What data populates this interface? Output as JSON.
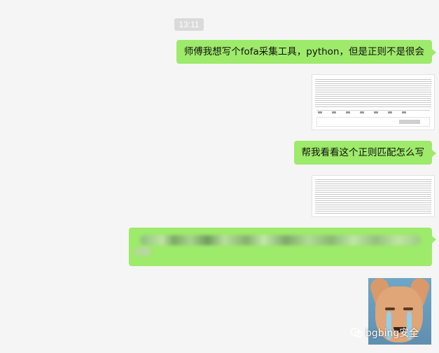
{
  "chat": {
    "timestamp": "13:11",
    "messages": [
      {
        "type": "text",
        "text": "师傅我想写个fofa采集工具，python，但是正则不是很会"
      },
      {
        "type": "image",
        "description": "screenshot"
      },
      {
        "type": "text",
        "text": "帮我看看这个正则匹配怎么写"
      },
      {
        "type": "image",
        "description": "screenshot"
      },
      {
        "type": "text",
        "text": ""
      },
      {
        "type": "image",
        "description": "sticker"
      }
    ]
  },
  "watermark": {
    "icon": "wechat-icon",
    "text": "bgbing安全"
  },
  "colors": {
    "background": "#f5f5f5",
    "bubble": "#9eea6a",
    "timestamp_bg": "#dadada"
  }
}
